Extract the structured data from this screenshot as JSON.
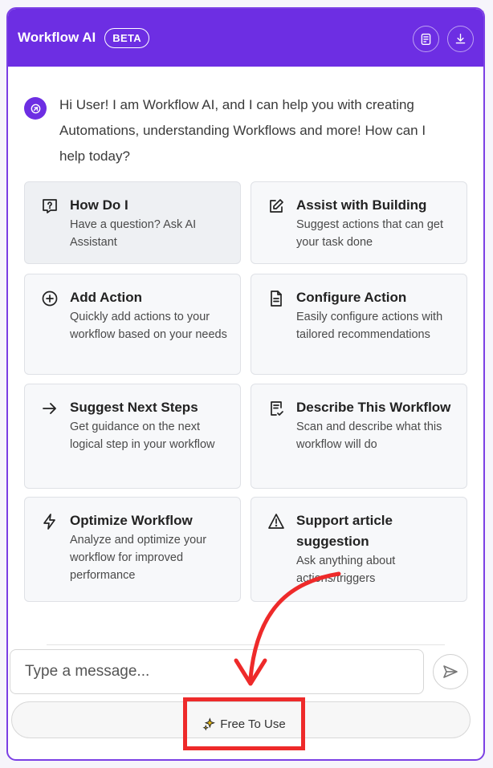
{
  "header": {
    "title": "Workflow AI",
    "badge": "BETA",
    "actions": [
      {
        "name": "clipboard-list-icon"
      },
      {
        "name": "download-icon"
      }
    ],
    "color": "#6d2ee3"
  },
  "greeting": {
    "text": "Hi User! I am Workflow AI, and I can help you with creating Automations, understanding Workflows and more! How can I help today?",
    "icon": "ai-sparkle-icon"
  },
  "cards": [
    {
      "title": "How Do I",
      "description": "Have a question? Ask AI Assistant",
      "icon": "question-box-icon",
      "active": true
    },
    {
      "title": "Assist with Building",
      "description": "Suggest actions that can get your task done",
      "icon": "edit-icon"
    },
    {
      "title": "Add Action",
      "description": "Quickly add actions to your workflow based on your needs",
      "icon": "plus-circle-icon"
    },
    {
      "title": "Configure Action",
      "description": "Easily configure actions with tailored recommendations",
      "icon": "document-icon"
    },
    {
      "title": "Suggest Next Steps",
      "description": "Get guidance on the next logical step in your workflow",
      "icon": "arrow-right-icon"
    },
    {
      "title": "Describe This Workflow",
      "description": "Scan and describe what this workflow will do",
      "icon": "document-check-icon"
    },
    {
      "title": "Optimize Workflow",
      "description": "Analyze and optimize your workflow for improved performance",
      "icon": "lightning-icon"
    },
    {
      "title": "Support article suggestion",
      "description": "Ask anything about actions/triggers",
      "icon": "warning-triangle-icon"
    }
  ],
  "composer": {
    "placeholder": "Type a message...",
    "send_icon": "send-icon"
  },
  "footer": {
    "label": "Free To Use",
    "icon": "sparkle-icon",
    "highlight_color": "#ee2a2a"
  }
}
